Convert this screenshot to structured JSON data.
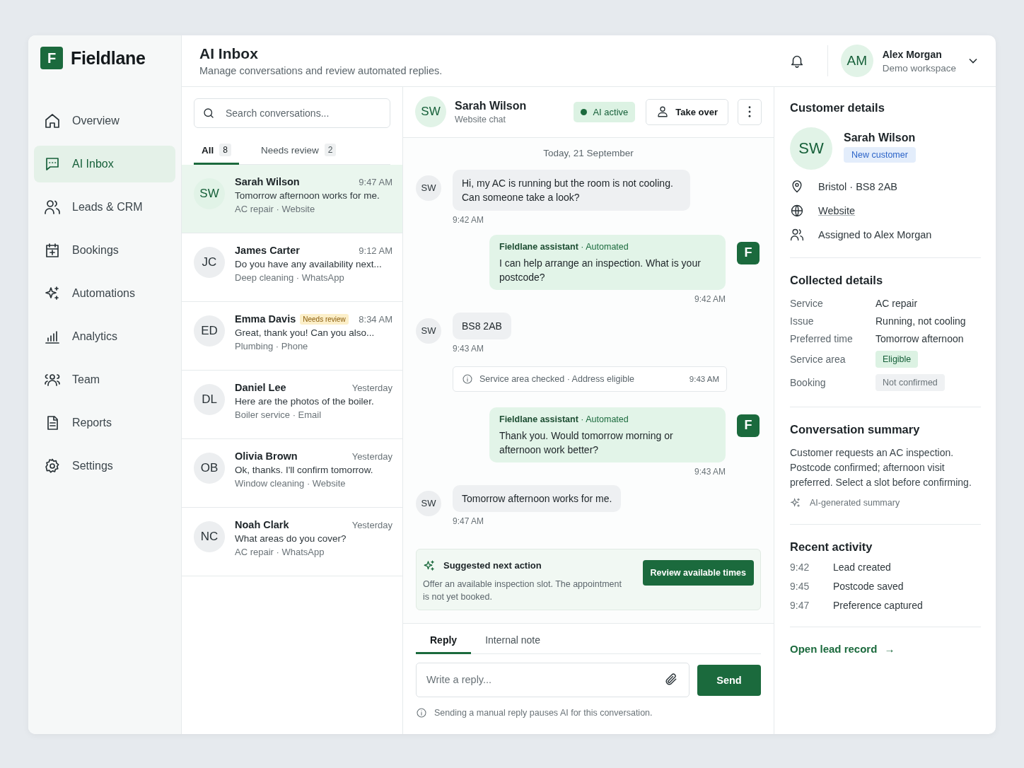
{
  "brand": {
    "logo_letter": "F",
    "name": "Fieldlane"
  },
  "sidebar": {
    "items": [
      {
        "label": "Overview",
        "selected": false
      },
      {
        "label": "AI Inbox",
        "selected": true
      },
      {
        "label": "Leads & CRM",
        "selected": false
      },
      {
        "label": "Bookings",
        "selected": false
      },
      {
        "label": "Automations",
        "selected": false
      },
      {
        "label": "Analytics",
        "selected": false
      },
      {
        "label": "Team",
        "selected": false
      },
      {
        "label": "Reports",
        "selected": false
      },
      {
        "label": "Settings",
        "selected": false
      }
    ]
  },
  "header": {
    "title": "AI Inbox",
    "subtitle": "Manage conversations and review automated replies.",
    "user": {
      "initials": "AM",
      "name": "Alex Morgan",
      "workspace": "Demo workspace"
    }
  },
  "conversation_list": {
    "search": {
      "placeholder": "Search conversations..."
    },
    "tabs": [
      {
        "label": "All",
        "count": "8",
        "selected": true
      },
      {
        "label": "Needs review",
        "count": "2",
        "selected": false
      }
    ],
    "items": [
      {
        "initials": "SW",
        "name": "Sarah Wilson",
        "time": "9:47 AM",
        "preview": "Tomorrow afternoon works for me.",
        "meta": "AC repair · Website",
        "selected": true
      },
      {
        "initials": "JC",
        "name": "James Carter",
        "time": "9:12 AM",
        "preview": "Do you have any availability next...",
        "meta": "Deep cleaning · WhatsApp",
        "selected": false
      },
      {
        "initials": "ED",
        "name": "Emma Davis",
        "badge": "Needs review",
        "time": "8:34 AM",
        "preview": "Great, thank you! Can you also...",
        "meta": "Plumbing · Phone",
        "selected": false
      },
      {
        "initials": "DL",
        "name": "Daniel Lee",
        "time": "Yesterday",
        "preview": "Here are the photos of the boiler.",
        "meta": "Boiler service · Email",
        "selected": false
      },
      {
        "initials": "OB",
        "name": "Olivia Brown",
        "time": "Yesterday",
        "preview": "Ok, thanks. I'll confirm tomorrow.",
        "meta": "Window cleaning · Website",
        "selected": false
      },
      {
        "initials": "NC",
        "name": "Noah Clark",
        "time": "Yesterday",
        "preview": "What areas do you cover?",
        "meta": "AC repair · WhatsApp",
        "selected": false
      }
    ]
  },
  "chat": {
    "contact": {
      "initials": "SW",
      "name": "Sarah Wilson",
      "channel": "Website chat"
    },
    "ai_status": {
      "label": "AI active",
      "on": true
    },
    "take_over_button": "Take over",
    "date_divider": "Today, 21 September",
    "messages": [
      {
        "kind": "customer",
        "initials": "SW",
        "text": "Hi, my AC is running but the room is not cooling. Can someone take a look?",
        "time": "9:42 AM"
      },
      {
        "kind": "assistant",
        "avatar": "F",
        "sender": "**Fieldlane assistant** · Automated",
        "text": "I can help arrange an inspection. What is your postcode?",
        "time": "9:42 AM"
      },
      {
        "kind": "customer",
        "initials": "SW",
        "text": "BS8 2AB",
        "time": "9:43 AM"
      },
      {
        "kind": "event",
        "text": "Service area checked · Address eligible",
        "time": "9:43 AM"
      },
      {
        "kind": "assistant",
        "avatar": "F",
        "sender": "**Fieldlane assistant** · Automated",
        "text": "Thank you. Would tomorrow morning or afternoon work better?",
        "time": "9:43 AM"
      },
      {
        "kind": "customer",
        "initials": "SW",
        "text": "Tomorrow afternoon works for me.",
        "time": "9:47 AM"
      }
    ],
    "suggestion": {
      "title": "Suggested next action",
      "text": "Offer an available inspection slot. The appointment is not yet booked.",
      "button": "Review available times"
    },
    "composer": {
      "tabs": [
        {
          "label": "Reply",
          "selected": true
        },
        {
          "label": "Internal note",
          "selected": false
        }
      ],
      "placeholder": "Write a reply...",
      "send_button": "Send",
      "note": "Sending a manual reply pauses AI for this conversation."
    }
  },
  "details": {
    "title": "Customer details",
    "customer": {
      "initials": "SW",
      "name": "Sarah Wilson",
      "badge": "New customer",
      "location": "Bristol · BS8 2AB",
      "source_link": "Website",
      "assigned": "Assigned to Alex Morgan"
    },
    "collected": {
      "title": "Collected details",
      "rows": [
        {
          "label": "Service",
          "value": "AC repair",
          "kind": "text"
        },
        {
          "label": "Issue",
          "value": "Running, not cooling",
          "kind": "text"
        },
        {
          "label": "Preferred time",
          "value": "Tomorrow afternoon",
          "kind": "text"
        },
        {
          "label": "Service area",
          "value": "Eligible",
          "kind": "success"
        },
        {
          "label": "Booking",
          "value": "Not confirmed",
          "kind": "pending"
        }
      ]
    },
    "summary": {
      "title": "Conversation summary",
      "text": "Customer requests an AC inspection. Postcode confirmed; afternoon visit preferred. Select a slot before confirming.",
      "footnote": "AI-generated summary"
    },
    "activity": {
      "title": "Recent activity",
      "items": [
        {
          "time": "9:42",
          "text": "Lead created"
        },
        {
          "time": "9:45",
          "text": "Postcode saved"
        },
        {
          "time": "9:47",
          "text": "Preference captured"
        }
      ]
    },
    "open_link": "Open lead record",
    "open_link_arrow": "→"
  }
}
